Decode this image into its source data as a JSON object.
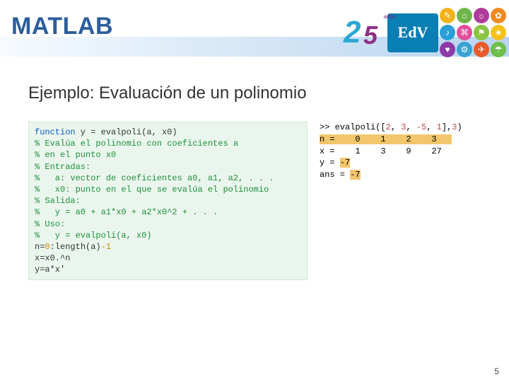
{
  "header": {
    "title": "MATLAB",
    "logo25_two": "2",
    "logo25_five": "5",
    "logo25_anos": "años",
    "logo_edv": "EdV"
  },
  "subtitle": "Ejemplo: Evaluación de un polinomio",
  "code_left": {
    "l1a": "function",
    "l1b": " y = evalpoli(a, x0)",
    "l2": "% Evalúa el polinomio con coeficientes a",
    "l3": "% en el punto x0",
    "l4": "% Entradas:",
    "l5": "%   a: vector de coeficientes a0, a1, a2, . . .",
    "l6": "%   x0: punto en el que se evalúa el polinomio",
    "l7": "% Salida:",
    "l8": "%   y = a0 + a1*x0 + a2*x0^2 + . . .",
    "l9": "% Uso:",
    "l10": "%   y = evalpoli(a, x0)",
    "l11a": "n=",
    "l11b": "0",
    "l11c": ":length(a)",
    "l11d": "-1",
    "l12": "x=x0.^n",
    "l13": "y=a*x'"
  },
  "code_right": {
    "r1a": ">> evalpoli([",
    "r1b": "2",
    "r1c": ", ",
    "r1d": "3",
    "r1e": ", ",
    "r1f": "-5",
    "r1g": ", ",
    "r1h": "1",
    "r1i": "],",
    "r1j": "3",
    "r1k": ")",
    "r2": "n =    0    1    2    3   ",
    "r3": "x =    1    3    9    27",
    "r4a": "y = ",
    "r4b": "-7",
    "r5a": "ans = ",
    "r5b": "-7"
  },
  "icons": {
    "colors": [
      "#f3b21b",
      "#6fb64a",
      "#b23a9a",
      "#f08a1d",
      "#2a9ed6",
      "#e14f9b",
      "#89c540",
      "#f6c21a",
      "#8d3aa8",
      "#3aa3d1",
      "#e85b2c",
      "#6cbf4a"
    ]
  },
  "page_number": "5"
}
